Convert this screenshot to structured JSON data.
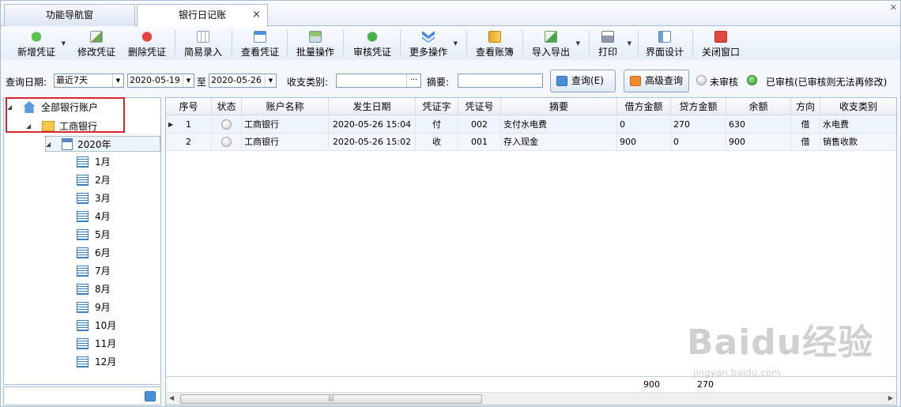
{
  "tabs": [
    {
      "label": "功能导航窗"
    },
    {
      "label": "银行日记账",
      "close": "×"
    }
  ],
  "toolbar": {
    "new_voucher": "新增凭证",
    "edit_voucher": "修改凭证",
    "delete_voucher": "删除凭证",
    "simple_entry": "简易录入",
    "view_voucher": "查看凭证",
    "batch_op": "批量操作",
    "audit_voucher": "审核凭证",
    "more_ops": "更多操作",
    "view_ledger": "查看账簿",
    "import_export": "导入导出",
    "print": "打印",
    "ui_design": "界面设计",
    "close_window": "关闭窗口"
  },
  "filter": {
    "date_label": "查询日期:",
    "range_value": "最近7天",
    "date_from": "2020-05-19",
    "to_label": "至",
    "date_to": "2020-05-26",
    "category_label": "收支类别:",
    "category_value": "",
    "category_more": "···",
    "summary_label": "摘要:",
    "summary_value": "",
    "query_button": "查询(E)",
    "advanced_button": "高级查询",
    "unaudited_label": "未审核",
    "audited_label": "已审核(已审核则无法再修改)"
  },
  "tree": {
    "root": "全部银行账户",
    "bank": "工商银行",
    "year": "2020年",
    "months": [
      "1月",
      "2月",
      "3月",
      "4月",
      "5月",
      "6月",
      "7月",
      "8月",
      "9月",
      "10月",
      "11月",
      "12月"
    ]
  },
  "grid": {
    "columns": [
      "序号",
      "状态",
      "账户名称",
      "发生日期",
      "凭证字",
      "凭证号",
      "摘要",
      "借方金额",
      "贷方金额",
      "余额",
      "方向",
      "收支类别"
    ],
    "rows": [
      {
        "seq": "1",
        "account": "工商银行",
        "date": "2020-05-26 15:04",
        "word": "付",
        "no": "002",
        "summary": "支付水电费",
        "debit": "0",
        "credit": "270",
        "balance": "630",
        "direction": "借",
        "category": "水电费"
      },
      {
        "seq": "2",
        "account": "工商银行",
        "date": "2020-05-26 15:02",
        "word": "收",
        "no": "001",
        "summary": "存入现金",
        "debit": "900",
        "credit": "0",
        "balance": "900",
        "direction": "借",
        "category": "销售收款"
      }
    ],
    "totals": {
      "debit": "900",
      "credit": "270"
    }
  },
  "watermark": {
    "brand": "Baidu经验",
    "url": "jingyan.baidu.com"
  },
  "colors": {
    "accent": "#3b7fc4",
    "highlight_border": "#d9262c",
    "audited_green": "#2e9e2a"
  }
}
